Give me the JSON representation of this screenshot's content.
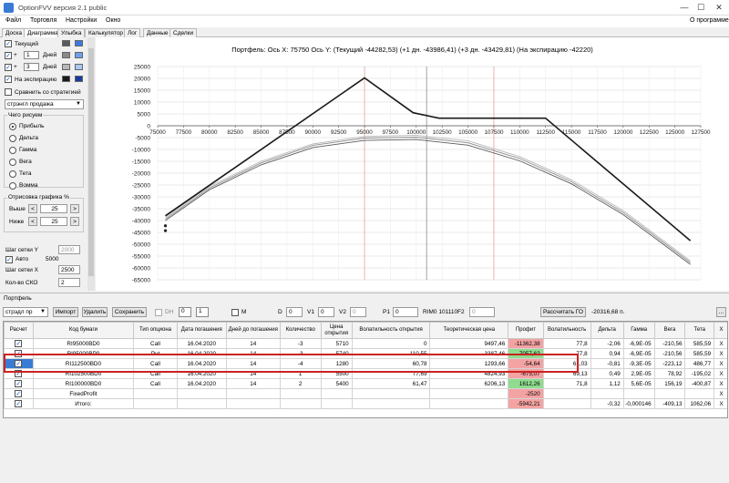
{
  "window": {
    "title": "OptionFVV версия 2.1 public",
    "buttons": [
      "—",
      "☐",
      "✕"
    ]
  },
  "menu": {
    "items": [
      "Файл",
      "Торговля",
      "Настройки",
      "Окно"
    ],
    "about": "О программе"
  },
  "tabs": [
    "Доска",
    "Диаграмма",
    "Улыбка",
    "Калькулятор",
    "Лог",
    "Данные",
    "Сделки"
  ],
  "active_tab": "Диаграмма",
  "left": {
    "current_label": "Текущий",
    "plus": "+",
    "days_label": "Дней",
    "day1": "1",
    "day2": "3",
    "expiry_label": "На экспирацию",
    "compare_label": "Сравнить со стратегией",
    "strategy_select": "стрэнгл продажа",
    "what_draw_title": "Чего рисуем",
    "radios": [
      "Прибыль",
      "Дельта",
      "Гамма",
      "Вега",
      "Тета",
      "Вомма"
    ],
    "selected_radio": "Прибыль",
    "render_title": "Отрисовка графика %",
    "above_label": "Выше",
    "below_label": "Ниже",
    "above_value": "25",
    "below_value": "25",
    "minus": "<",
    "plusbtn": ">",
    "grid_y_label": "Шаг сетки Y",
    "grid_y_value": "2000",
    "auto_label": "Авто",
    "auto_value": "5000",
    "grid_x_label": "Шаг сетки X",
    "grid_x_value": "2500",
    "sko_label": "Кол-во СКО",
    "sko_value": "2",
    "colors": [
      "#5a5a5a",
      "#3c78e0",
      "#8a8a8a",
      "#6fa0ef",
      "#b8b8b8",
      "#a9c8f4",
      "#1a1a1a",
      "#1a3ca0"
    ]
  },
  "chart": {
    "caption": "Портфель:  Ось X:  75750   Ось Y:   (Текущий -44282,53)   (+1 дн. -43986,41)   (+3 дн. -43429,81)   (На экспирацию -42220)"
  },
  "chart_data": {
    "type": "line",
    "xlim": [
      75000,
      127500
    ],
    "ylim": [
      -65000,
      25000
    ],
    "x_ticks": [
      75000,
      77500,
      80000,
      82500,
      85000,
      87500,
      90000,
      92500,
      95000,
      97500,
      100000,
      102500,
      105000,
      107500,
      110000,
      112500,
      115000,
      117500,
      120000,
      122500,
      125000,
      127500
    ],
    "y_ticks": [
      25000,
      20000,
      15000,
      10000,
      5000,
      0,
      -5000,
      -10000,
      -15000,
      -20000,
      -25000,
      -30000,
      -35000,
      -40000,
      -45000,
      -50000,
      -55000,
      -60000,
      -65000
    ],
    "vlines_red": [
      95000,
      107500
    ],
    "vline_current": 101000,
    "series": [
      {
        "name": "На экспирацию",
        "color": "#1a1a1a",
        "x": [
          75750,
          95000,
          99700,
          102200,
          112500,
          126500
        ],
        "y": [
          -38000,
          20200,
          5500,
          3200,
          3200,
          -48500
        ]
      },
      {
        "name": "Текущий",
        "color": "#5a5a5a",
        "x": [
          75750,
          80000,
          85000,
          90000,
          95000,
          100000,
          105000,
          110000,
          115000,
          120000,
          126500
        ],
        "y": [
          -40000,
          -27000,
          -16500,
          -9200,
          -6200,
          -5800,
          -8200,
          -14800,
          -24500,
          -37500,
          -58500
        ]
      },
      {
        "name": "+1 дн.",
        "color": "#8a8a8a",
        "x": [
          75750,
          80000,
          85000,
          90000,
          95000,
          100000,
          105000,
          110000,
          115000,
          120000,
          126500
        ],
        "y": [
          -39300,
          -26300,
          -15700,
          -8300,
          -5200,
          -4800,
          -7200,
          -13800,
          -23600,
          -36600,
          -57700
        ]
      },
      {
        "name": "+3 дн.",
        "color": "#b8b8b8",
        "x": [
          75750,
          80000,
          85000,
          90000,
          95000,
          100000,
          105000,
          110000,
          115000,
          120000,
          126500
        ],
        "y": [
          -38600,
          -25600,
          -15000,
          -7700,
          -4500,
          -4000,
          -6400,
          -13000,
          -22800,
          -35800,
          -57000
        ]
      }
    ],
    "markers": [
      {
        "x": 75750,
        "y": -42220
      },
      {
        "x": 75750,
        "y": -44282.53
      }
    ]
  },
  "bottombar": {
    "portfolio_label": "Портфель",
    "portfolio_select": "стрэдл пр",
    "import": "Импорт",
    "delete": "Удалить",
    "save": "Сохранить",
    "dh_label": "DH",
    "dh_val1": "0",
    "dh_val2": "1",
    "m_label": "M",
    "d_label": "D",
    "d_val": "0",
    "v1_label": "V1",
    "v1_val": "0",
    "v2_label": "V2",
    "v2_val": "0",
    "p1_label": "P1",
    "p1_val": "0",
    "instrument": "RIM0 101110",
    "f2_label": "F2",
    "f2_val": "0",
    "go_button": "Рассчитать ГО",
    "go_value": "-20316,68 п.",
    "dots": "..."
  },
  "table": {
    "headers": [
      "Расчет",
      "Код бумаги",
      "Тип опциона",
      "Дата погашения",
      "Дней до погашения",
      "Количество",
      "Цена открытия",
      "Волатильность открытия",
      "Теоретическая цена",
      "Профит",
      "Волатильность",
      "Дельта",
      "Гамма",
      "Вега",
      "Тета",
      "X"
    ],
    "rows": [
      {
        "code": "RI95000BD0",
        "type": "Call",
        "date": "16.04.2020",
        "days": "14",
        "qty": "-3",
        "price": "5710",
        "vol_open": "0",
        "theo": "9497,46",
        "profit": "-11362,38",
        "profit_state": "neg",
        "vol": "77,8",
        "delta": "-2,06",
        "gamma": "-6,9E-05",
        "vega": "-210,56",
        "theta": "585,59",
        "x": "X"
      },
      {
        "code": "RI95000BP0",
        "type": "Put",
        "date": "16.04.2020",
        "days": "14",
        "qty": "-3",
        "price": "5740",
        "vol_open": "110,55",
        "theo": "3387,46",
        "profit": "7057,62",
        "profit_state": "pos",
        "vol": "77,8",
        "delta": "0,94",
        "gamma": "-6,9E-05",
        "vega": "-210,56",
        "theta": "585,59",
        "x": "X"
      },
      {
        "code": "RI112500BD0",
        "type": "Call",
        "date": "16.04.2020",
        "days": "14",
        "qty": "-4",
        "price": "1280",
        "vol_open": "60,78",
        "theo": "1293,66",
        "profit": "-54,64",
        "profit_state": "neg",
        "vol": "61,03",
        "delta": "-0,81",
        "gamma": "-9,3E-05",
        "vega": "-223,12",
        "theta": "486,77",
        "x": "X"
      },
      {
        "code": "RI102500BD0",
        "type": "Call",
        "date": "16.04.2020",
        "days": "14",
        "qty": "1",
        "price": "5500",
        "vol_open": "77,69",
        "theo": "4824,93",
        "profit": "-675,07",
        "profit_state": "neg",
        "vol": "69,13",
        "delta": "0,49",
        "gamma": "2,9E-05",
        "vega": "78,92",
        "theta": "-195,02",
        "x": "X"
      },
      {
        "code": "RI100000BD0",
        "type": "Call",
        "date": "16.04.2020",
        "days": "14",
        "qty": "2",
        "price": "5400",
        "vol_open": "61,47",
        "theo": "6206,13",
        "profit": "1612,26",
        "profit_state": "pos",
        "vol": "71,8",
        "delta": "1,12",
        "gamma": "5,6E-05",
        "vega": "156,19",
        "theta": "-400,87",
        "x": "X"
      },
      {
        "code": "FixedProfit",
        "type": "",
        "date": "",
        "days": "",
        "qty": "",
        "price": "",
        "vol_open": "",
        "theo": "",
        "profit": "-2520",
        "profit_state": "neg",
        "vol": "",
        "delta": "",
        "gamma": "",
        "vega": "",
        "theta": "",
        "x": "X"
      },
      {
        "code": "Итого:",
        "type": "",
        "date": "",
        "days": "",
        "qty": "",
        "price": "",
        "vol_open": "",
        "theo": "",
        "profit": "-5942,21",
        "profit_state": "neg",
        "vol": "",
        "delta": "-0,32",
        "gamma": "-0,000146",
        "vega": "-409,13",
        "theta": "1062,06",
        "x": "X"
      }
    ]
  }
}
